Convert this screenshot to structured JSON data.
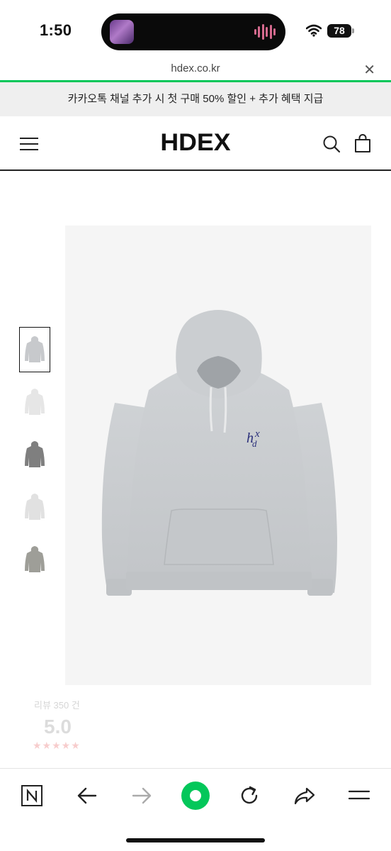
{
  "status_bar": {
    "time": "1:50",
    "battery": "78"
  },
  "browser": {
    "url": "hdex.co.kr",
    "close_symbol": "✕"
  },
  "promo": {
    "text": "카카오톡 채널 추가 시 첫 구매 50% 할인 + 추가 혜택 지급"
  },
  "header": {
    "logo": "HDEX"
  },
  "product": {
    "thumbnails": [
      {
        "color": "#c7c9cc",
        "active": true
      },
      {
        "color": "#e6e6e6",
        "active": false
      },
      {
        "color": "#7f7f7f",
        "active": false
      },
      {
        "color": "#e1e1e1",
        "active": false
      },
      {
        "color": "#9e9e98",
        "active": false
      }
    ],
    "main_color": "#c8cbce",
    "logo_color": "#2a2f7a",
    "rating": {
      "count_text": "리뷰 350 건",
      "score": "5.0",
      "stars": "★★★★★"
    }
  },
  "toolbar": {
    "accent": "#03c75a",
    "icons": [
      "naver-n-icon",
      "back-arrow-icon",
      "forward-arrow-icon",
      "green-home-icon",
      "reload-icon",
      "share-icon",
      "menu-icon"
    ]
  }
}
